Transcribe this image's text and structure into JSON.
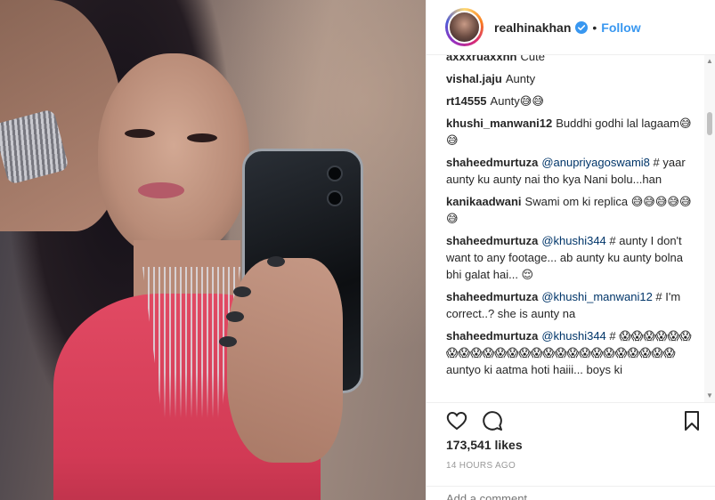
{
  "post": {
    "username": "realhinakhan",
    "verified": true,
    "follow_label": "Follow",
    "separator": "•"
  },
  "comments": [
    {
      "user": "axxxruaxxhh",
      "parts": [
        {
          "t": "text",
          "v": "Cute"
        }
      ]
    },
    {
      "user": "vishal.jaju",
      "parts": [
        {
          "t": "text",
          "v": "Aunty"
        }
      ]
    },
    {
      "user": "rt14555",
      "parts": [
        {
          "t": "text",
          "v": "Aunty😅😅"
        }
      ]
    },
    {
      "user": "khushi_manwani12",
      "parts": [
        {
          "t": "text",
          "v": "Buddhi godhi lal lagaam😅😅"
        }
      ]
    },
    {
      "user": "shaheedmurtuza",
      "parts": [
        {
          "t": "mention",
          "v": "@anupriyagoswami8"
        },
        {
          "t": "text",
          "v": " # yaar aunty ku aunty nai tho kya Nani bolu...han"
        }
      ]
    },
    {
      "user": "kanikaadwani",
      "parts": [
        {
          "t": "text",
          "v": "Swami om ki replica 😅😅😅😅😅😅"
        }
      ]
    },
    {
      "user": "shaheedmurtuza",
      "parts": [
        {
          "t": "mention",
          "v": "@khushi344"
        },
        {
          "t": "text",
          "v": " # aunty I don't want to any footage... ab aunty ku aunty bolna bhi galat hai... 😌"
        }
      ]
    },
    {
      "user": "shaheedmurtuza",
      "parts": [
        {
          "t": "mention",
          "v": "@khushi_manwani12"
        },
        {
          "t": "text",
          "v": " # I'm correct..? she is aunty na"
        }
      ]
    },
    {
      "user": "shaheedmurtuza",
      "parts": [
        {
          "t": "mention",
          "v": "@khushi344"
        },
        {
          "t": "text",
          "v": " # 😱😱😱😱😱😱😱😱😱😱😱😱😱😱😱😱😱😱😱😱😱😱😱😱😱 auntyo ki aatma hoti haiii... boys ki"
        }
      ]
    }
  ],
  "actions": {
    "like_icon": "heart-outline-icon",
    "comment_icon": "speech-bubble-icon",
    "save_icon": "bookmark-icon"
  },
  "likes_text": "173,541 likes",
  "timestamp": "14 HOURS AGO",
  "add_comment_placeholder": "Add a comment...",
  "colors": {
    "follow": "#3897f0",
    "verified": "#3897f0",
    "text": "#262626",
    "muted": "#999999",
    "mention": "#003569"
  }
}
